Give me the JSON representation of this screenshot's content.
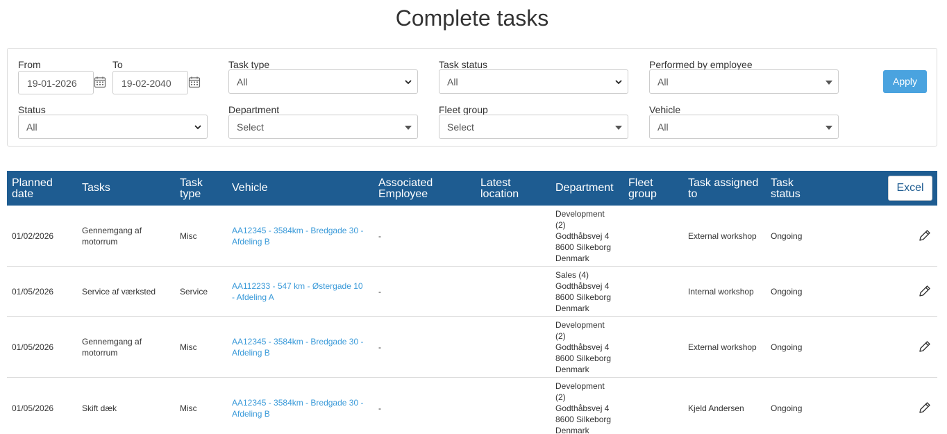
{
  "page": {
    "title": "Complete tasks"
  },
  "filters": {
    "from_label": "From",
    "from_value": "19-01-2026",
    "to_label": "To",
    "to_value": "19-02-2040",
    "task_type_label": "Task type",
    "task_type_value": "All",
    "task_status_label": "Task status",
    "task_status_value": "All",
    "performed_by_label": "Performed by employee",
    "performed_by_value": "All",
    "status_label": "Status",
    "status_value": "All",
    "department_label": "Department",
    "department_value": "Select",
    "fleet_group_label": "Fleet group",
    "fleet_group_value": "Select",
    "vehicle_label": "Vehicle",
    "vehicle_value": "All",
    "apply_label": "Apply"
  },
  "table": {
    "headers": {
      "planned_date": [
        "Planned",
        "date"
      ],
      "tasks": [
        "Tasks"
      ],
      "task_type": [
        "Task",
        "type"
      ],
      "vehicle": [
        "Vehicle"
      ],
      "associated_employee": [
        "Associated",
        "Employee"
      ],
      "latest_location": [
        "Latest",
        "location"
      ],
      "department": [
        "Department"
      ],
      "fleet_group": [
        "Fleet",
        "group"
      ],
      "task_assigned_to": [
        "Task assigned",
        "to"
      ],
      "task_status": [
        "Task",
        "status"
      ]
    },
    "excel_label": "Excel",
    "rows": [
      {
        "planned_date": "01/02/2026",
        "task": [
          "Gennemgang af",
          "motorrum"
        ],
        "task_type": "Misc",
        "vehicle": [
          "AA12345 - 3584km - Bredgade 30 -",
          "Afdeling B"
        ],
        "employee": "-",
        "department": [
          "Development",
          "(2)",
          "Godthåbsvej 4",
          "8600 Silkeborg",
          "Denmark"
        ],
        "assigned_to": "External workshop",
        "status": "Ongoing"
      },
      {
        "planned_date": "01/05/2026",
        "task": [
          "Service af værksted"
        ],
        "task_type": "Service",
        "vehicle": [
          "AA112233 - 547 km - Østergade 10",
          "- Afdeling A"
        ],
        "employee": "-",
        "department": [
          "Sales (4)",
          "Godthåbsvej 4",
          "8600 Silkeborg",
          "Denmark"
        ],
        "assigned_to": "Internal workshop",
        "status": "Ongoing"
      },
      {
        "planned_date": "01/05/2026",
        "task": [
          "Gennemgang af",
          "motorrum"
        ],
        "task_type": "Misc",
        "vehicle": [
          "AA12345 - 3584km - Bredgade 30 -",
          "Afdeling B"
        ],
        "employee": "-",
        "department": [
          "Development",
          "(2)",
          "Godthåbsvej 4",
          "8600 Silkeborg",
          "Denmark"
        ],
        "assigned_to": "External workshop",
        "status": "Ongoing"
      },
      {
        "planned_date": "01/05/2026",
        "task": [
          "Skift dæk"
        ],
        "task_type": "Misc",
        "vehicle": [
          "AA12345 - 3584km - Bredgade 30 -",
          "Afdeling B"
        ],
        "employee": "-",
        "department": [
          "Development",
          "(2)",
          "Godthåbsvej 4",
          "8600 Silkeborg",
          "Denmark"
        ],
        "assigned_to": "Kjeld Andersen",
        "status": "Ongoing"
      }
    ]
  },
  "icons": {
    "calendar": "calendar-icon",
    "chevron": "chevron-down-icon",
    "caret": "caret-down-icon",
    "edit": "pencil-icon"
  },
  "colors": {
    "header_bg": "#1e5c91",
    "apply_bg": "#4aa3df",
    "link": "#3a9ad9"
  }
}
